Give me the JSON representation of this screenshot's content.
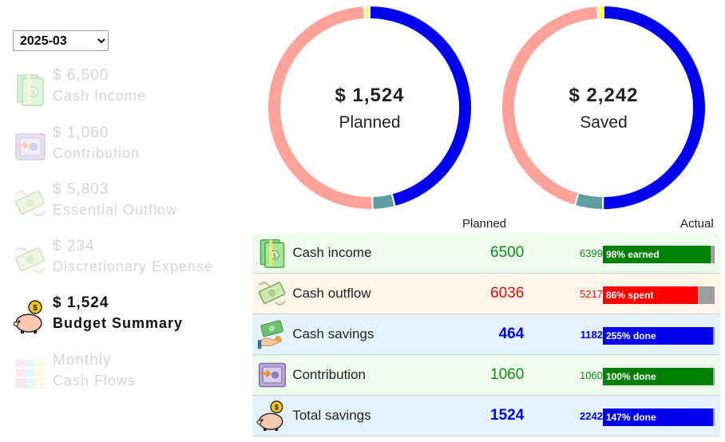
{
  "month_select": {
    "value": "2025-03",
    "options": [
      "2025-03"
    ]
  },
  "sidebar": {
    "items": [
      {
        "amount": "$ 6,500",
        "label": "Cash Income",
        "icon": "cash-stack-icon",
        "active": false
      },
      {
        "amount": "$ 1,060",
        "label": "Contribution",
        "icon": "safe-icon",
        "active": false
      },
      {
        "amount": "$ 5,803",
        "label": "Essential Outflow",
        "icon": "flying-money-icon",
        "active": false
      },
      {
        "amount": "$ 234",
        "label": "Discretionary Expense",
        "icon": "flying-money-icon",
        "active": false
      },
      {
        "amount": "$ 1,524",
        "label": "Budget Summary",
        "icon": "piggy-bank-icon",
        "active": true
      },
      {
        "amount": "Monthly",
        "label": "Cash Flows",
        "icon": "calendar-flow-icon",
        "active": false
      }
    ]
  },
  "donuts": [
    {
      "center_amount": "$ 1,524",
      "center_label": "Planned",
      "segments": [
        {
          "value": 6036,
          "color": "#0000ee"
        },
        {
          "value": 464,
          "color": "#5f9ea0"
        },
        {
          "value": 6500,
          "color": "#ffa29a"
        },
        {
          "value": 120,
          "color": "#ffff55"
        }
      ]
    },
    {
      "center_amount": "$ 2,242",
      "center_label": "Saved",
      "segments": [
        {
          "value": 5217,
          "color": "#0000ee"
        },
        {
          "value": 464,
          "color": "#5f9ea0"
        },
        {
          "value": 4630,
          "color": "#ffa29a"
        },
        {
          "value": 100,
          "color": "#ffff55"
        }
      ]
    }
  ],
  "table": {
    "planned_header": "Planned",
    "actual_header": "Actual",
    "rows": [
      {
        "label": "Cash income",
        "planned": "6500",
        "actual": "6399",
        "bar_text": "98% earned",
        "bar_pct": 0.98,
        "bar_color": "#008000",
        "text_color": "#138a13",
        "bg": "#ecfbec",
        "icon": "cash-stack-icon",
        "bold": false
      },
      {
        "label": "Cash outflow",
        "planned": "6036",
        "actual": "5217",
        "bar_text": "86% spent",
        "bar_pct": 0.86,
        "bar_color": "#ff0000",
        "text_color": "#e01010",
        "bg": "#fdf5e8",
        "icon": "flying-money-icon",
        "bold": false
      },
      {
        "label": "Cash savings",
        "planned": "464",
        "actual": "1182",
        "bar_text": "255% done",
        "bar_pct": 1.0,
        "bar_color": "#0000ee",
        "text_color": "#0000dd",
        "bg": "#e4f3fb",
        "icon": "money-hand-icon",
        "bold": true
      },
      {
        "label": "Contribution",
        "planned": "1060",
        "actual": "1060",
        "bar_text": "100% done",
        "bar_pct": 1.0,
        "bar_color": "#008000",
        "text_color": "#138a13",
        "bg": "#ecfbec",
        "icon": "safe-icon",
        "bold": false
      },
      {
        "label": "Total savings",
        "planned": "1524",
        "actual": "2242",
        "bar_text": "147% done",
        "bar_pct": 1.0,
        "bar_color": "#0000ee",
        "text_color": "#0000dd",
        "bg": "#e4f3fb",
        "icon": "piggy-bank-icon",
        "bold": true
      }
    ]
  }
}
